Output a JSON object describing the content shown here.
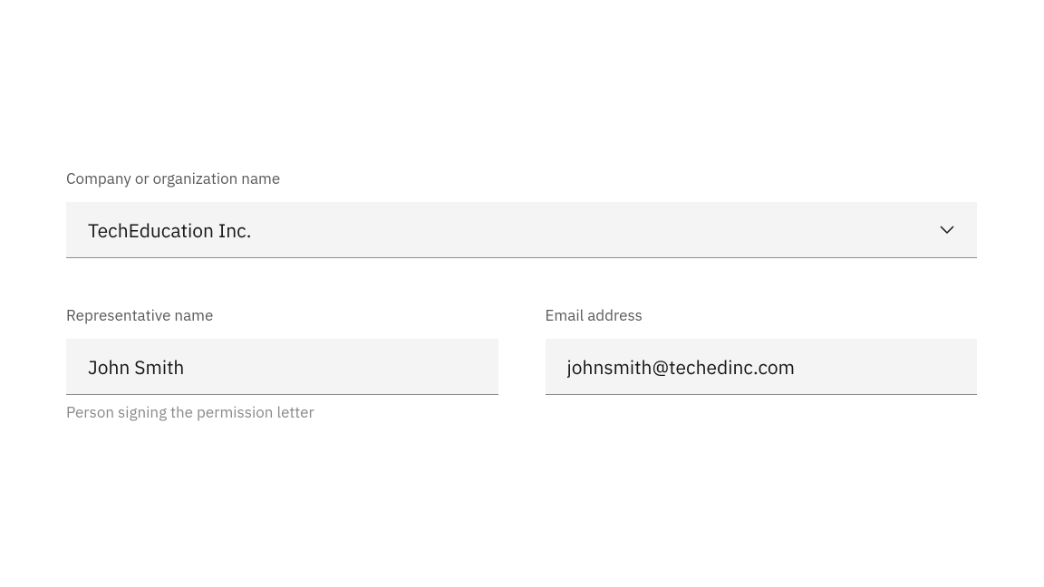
{
  "company": {
    "label": "Company or organization name",
    "value": "TechEducation Inc."
  },
  "representative": {
    "label": "Representative name",
    "value": "John Smith",
    "helper": "Person signing the permission letter"
  },
  "email": {
    "label": "Email address",
    "value": "johnsmith@techedinc.com"
  }
}
